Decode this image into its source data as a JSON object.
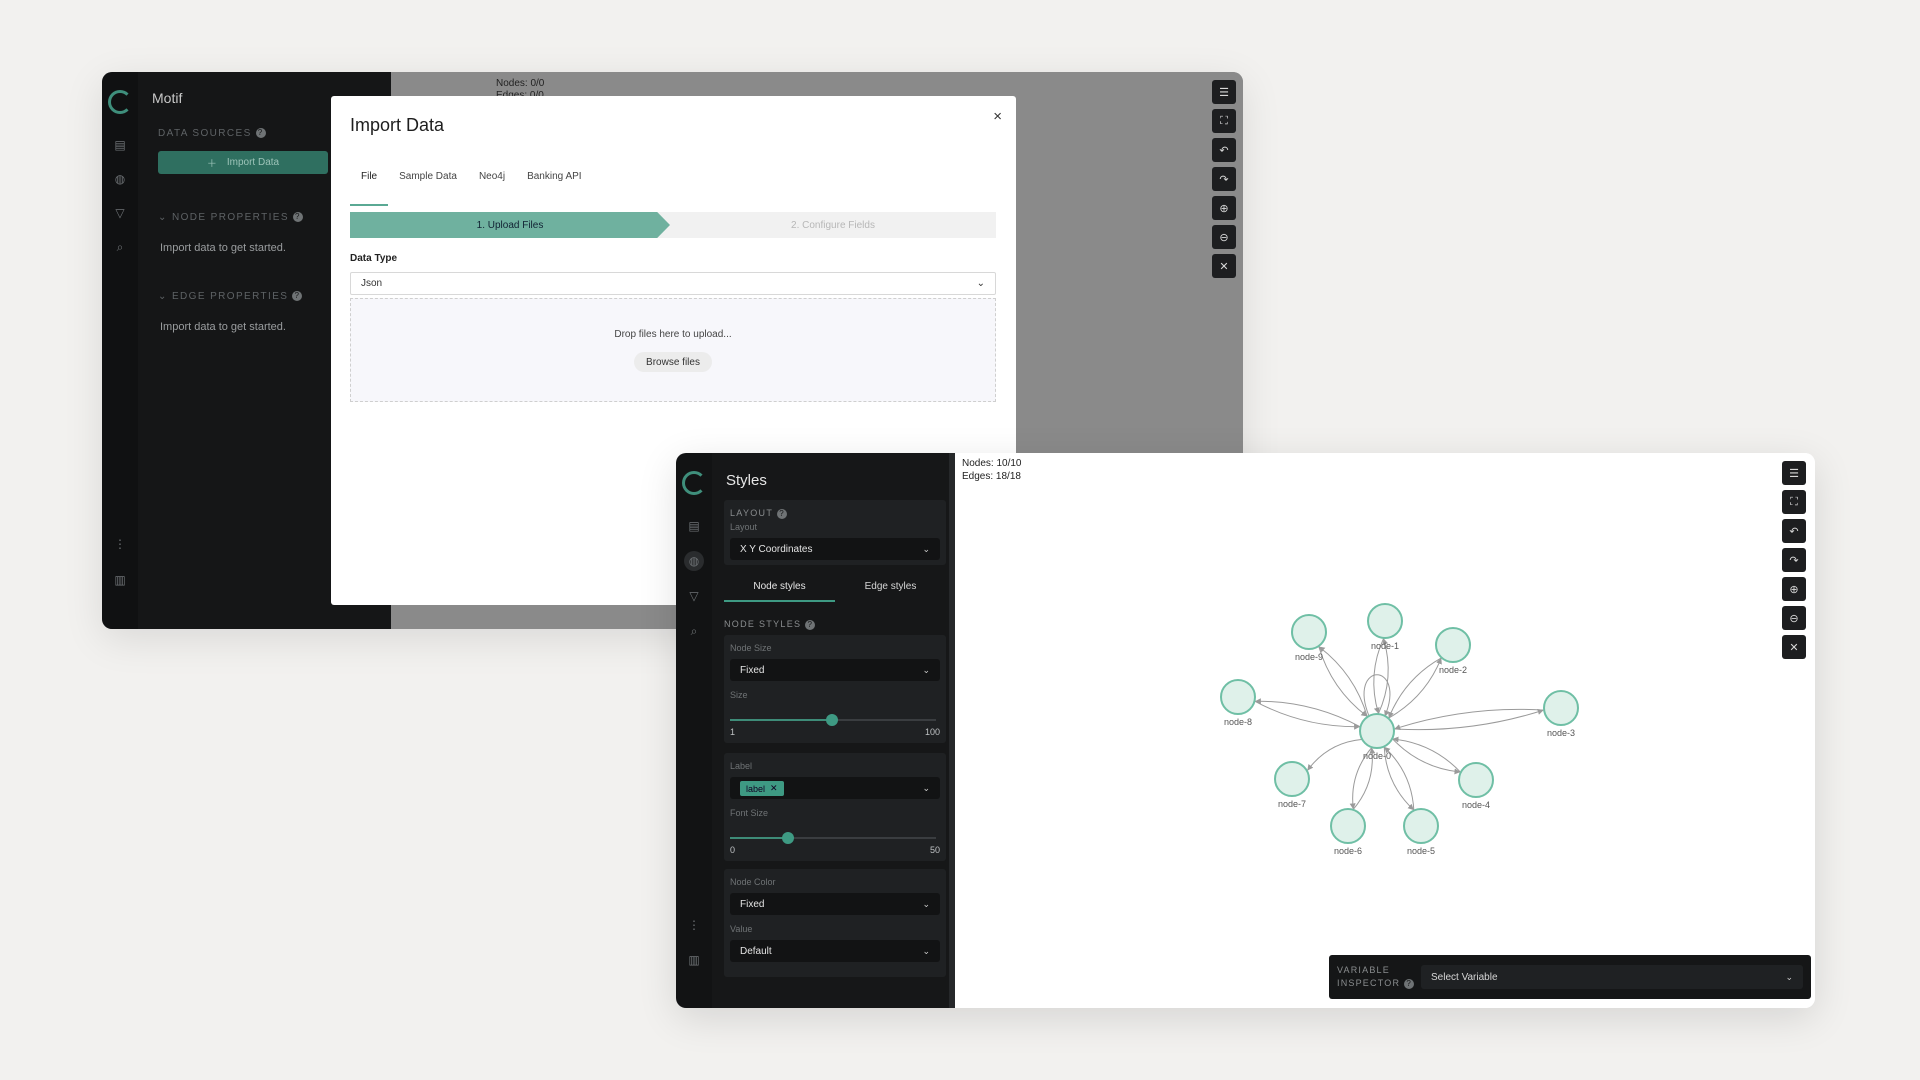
{
  "window1": {
    "app_name": "Motif",
    "sidebar": {
      "data_sources_header": "DATA SOURCES",
      "import_button": "Import Data",
      "node_properties_header": "NODE PROPERTIES",
      "node_properties_text": "Import data to get started.",
      "edge_properties_header": "EDGE PROPERTIES",
      "edge_properties_text": "Import data to get started."
    },
    "canvas": {
      "nodes_count": "Nodes: 0/0",
      "edges_count": "Edges: 0/0"
    },
    "modal": {
      "title": "Import Data",
      "close": "×",
      "tabs": [
        "File",
        "Sample Data",
        "Neo4j",
        "Banking API"
      ],
      "steps": [
        "1. Upload Files",
        "2. Configure Fields"
      ],
      "data_type_label": "Data Type",
      "data_type_value": "Json",
      "drop_text": "Drop files here to upload...",
      "browse_button": "Browse files"
    }
  },
  "window2": {
    "sidebar_title": "Styles",
    "layout_header": "LAYOUT",
    "layout_label": "Layout",
    "layout_value": "X Y Coordinates",
    "subtabs": [
      "Node styles",
      "Edge styles"
    ],
    "node_styles_header": "NODE STYLES",
    "node_size_label": "Node Size",
    "node_size_value": "Fixed",
    "size_label": "Size",
    "size_slider": {
      "min": "1",
      "max": "100",
      "value": 50
    },
    "label_label": "Label",
    "label_chip": "label",
    "font_size_label": "Font Size",
    "font_size_slider": {
      "min": "0",
      "max": "50",
      "value": 14
    },
    "node_color_label": "Node Color",
    "node_color_value": "Fixed",
    "value_label": "Value",
    "value_value": "Default",
    "canvas": {
      "nodes_count": "Nodes: 10/10",
      "edges_count": "Edges: 18/18"
    },
    "variable_inspector": {
      "label_line1": "VARIABLE",
      "label_line2": "INSPECTOR",
      "placeholder": "Select Variable"
    },
    "graph": {
      "nodes": [
        "node-0",
        "node-1",
        "node-2",
        "node-3",
        "node-4",
        "node-5",
        "node-6",
        "node-7",
        "node-8",
        "node-9"
      ],
      "node_fill": "#dff1ea",
      "node_stroke": "#6fbfa5",
      "edge_color": "#9a9a9a"
    }
  },
  "colors": {
    "accent": "#3e9a83",
    "dark_panel": "#161718"
  }
}
